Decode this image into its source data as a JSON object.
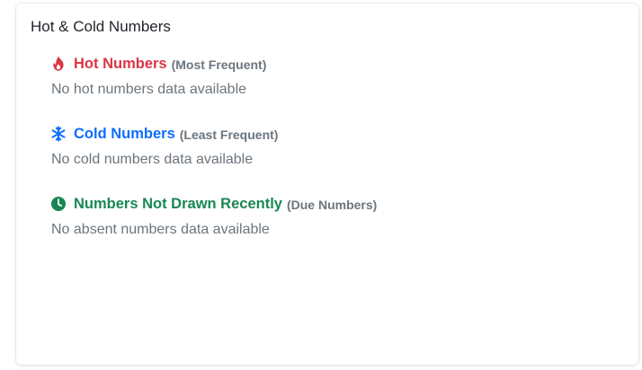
{
  "card": {
    "title": "Hot & Cold Numbers"
  },
  "sections": [
    {
      "icon": "fire-icon",
      "title": "Hot Numbers",
      "subtitle": "(Most Frequent)",
      "empty_text": "No hot numbers data available",
      "color": "#dc3545"
    },
    {
      "icon": "snowflake-icon",
      "title": "Cold Numbers",
      "subtitle": "(Least Frequent)",
      "empty_text": "No cold numbers data available",
      "color": "#0d6efd"
    },
    {
      "icon": "clock-icon",
      "title": "Numbers Not Drawn Recently",
      "subtitle": "(Due Numbers)",
      "empty_text": "No absent numbers data available",
      "color": "#198754"
    }
  ]
}
